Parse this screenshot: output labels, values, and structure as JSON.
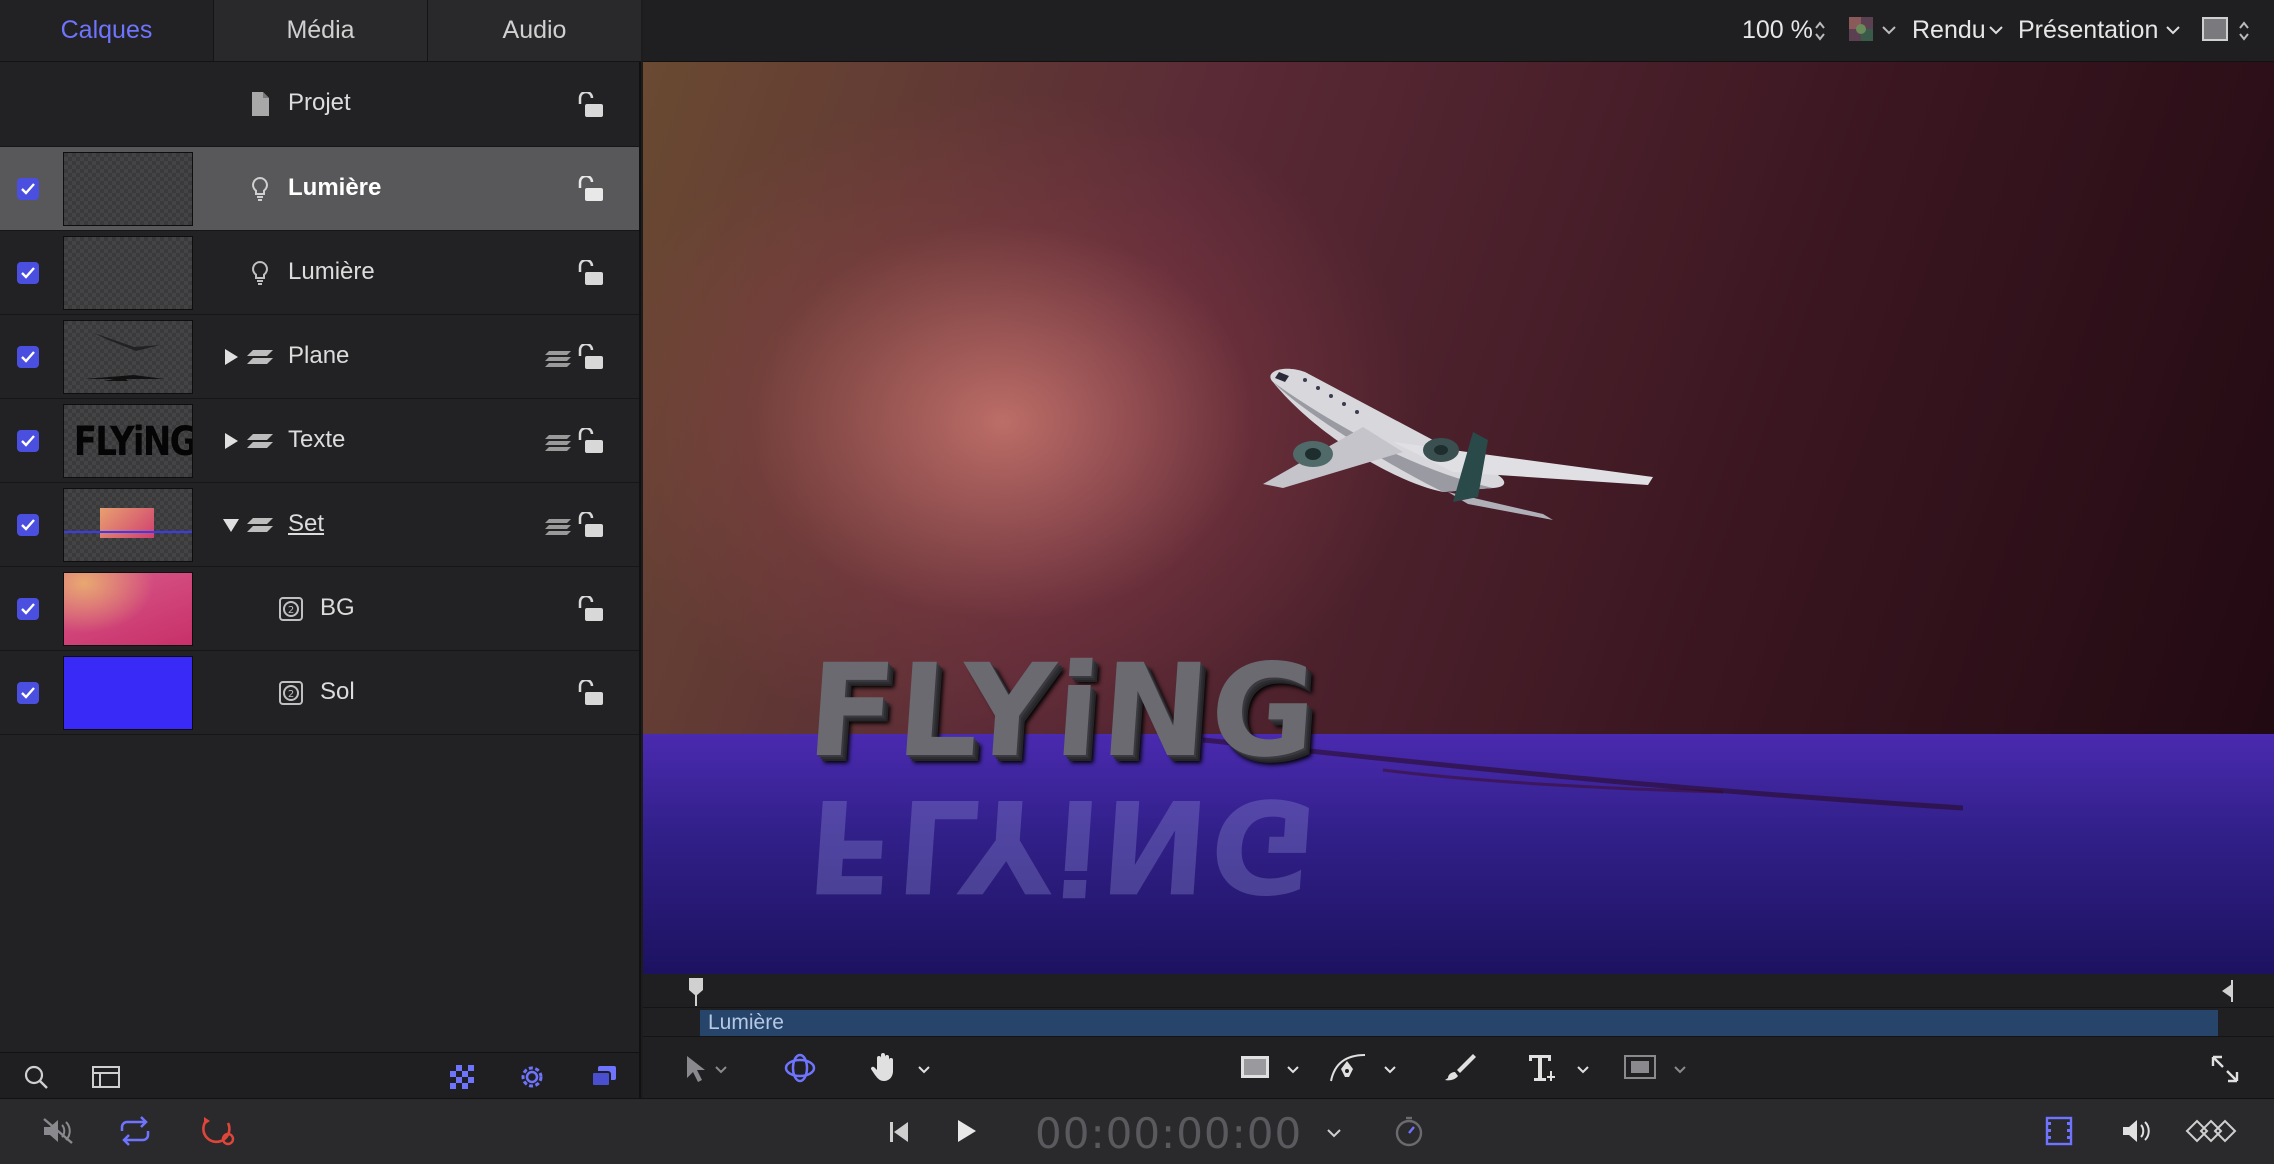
{
  "tabs": [
    {
      "label": "Calques",
      "active": true
    },
    {
      "label": "Média",
      "active": false
    },
    {
      "label": "Audio",
      "active": false
    }
  ],
  "layers": {
    "project": {
      "label": "Projet"
    },
    "rows": [
      {
        "label": "Lumière",
        "checked": true,
        "selected": true
      },
      {
        "label": "Lumière",
        "checked": true
      },
      {
        "label": "Plane",
        "checked": true
      },
      {
        "label": "Texte",
        "checked": true
      },
      {
        "label": "Set",
        "checked": true
      },
      {
        "label": "BG",
        "checked": true
      },
      {
        "label": "Sol",
        "checked": true
      }
    ],
    "thumb_flying_text": "FLYiNG"
  },
  "topbar": {
    "zoom": "100 %",
    "render": "Rendu",
    "presentation": "Présentation"
  },
  "canvas": {
    "title_text": "FLYiNG"
  },
  "timeline": {
    "clip_label": "Lumière"
  },
  "transport": {
    "timecode": "00:00:00:00"
  },
  "colors": {
    "accent": "#6f74ff",
    "checkbox": "#4a4fe0",
    "record": "#e0453a",
    "clip": "#27456b"
  }
}
